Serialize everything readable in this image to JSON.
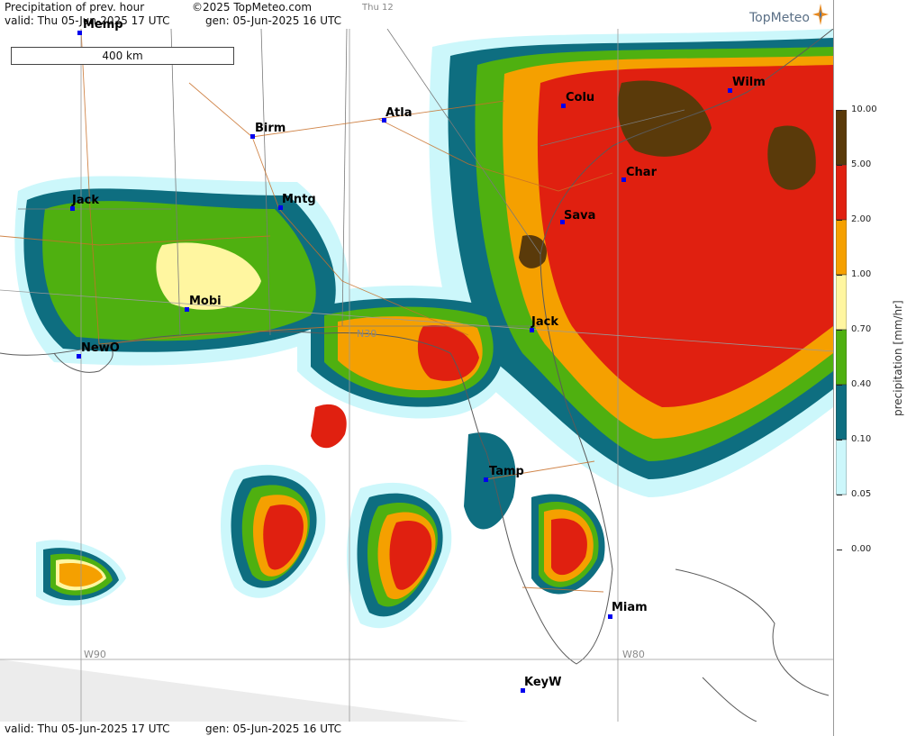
{
  "header": {
    "title": "Precipitation of prev. hour",
    "copyright": "©2025 TopMeteo.com",
    "valid": "valid:  Thu  05-Jun-2025  17 UTC",
    "gen": "gen:  05-Jun-2025 16 UTC",
    "day": "Thu 12"
  },
  "footer": {
    "valid": "valid:  Thu  05-Jun-2025  17 UTC",
    "gen": "gen:  05-Jun-2025 16 UTC"
  },
  "logo": {
    "text": "TopMeteo"
  },
  "scale_bar": {
    "label": "400 km"
  },
  "grid_labels": {
    "w90": "W90",
    "w80": "W80",
    "n30": "N30"
  },
  "cities": [
    {
      "name": "Memp"
    },
    {
      "name": "Atla"
    },
    {
      "name": "Birm"
    },
    {
      "name": "Colu"
    },
    {
      "name": "Wilm"
    },
    {
      "name": "Char"
    },
    {
      "name": "Sava"
    },
    {
      "name": "Jack"
    },
    {
      "name": "Mntg"
    },
    {
      "name": "Mobi"
    },
    {
      "name": "NewO"
    },
    {
      "name": "Jack"
    },
    {
      "name": "Tamp"
    },
    {
      "name": "Miam"
    },
    {
      "name": "KeyW"
    }
  ],
  "legend": {
    "title": "precipitation  [mm/hr]",
    "ticks": [
      "10.00",
      "5.00",
      "2.00",
      "1.00",
      "0.70",
      "0.40",
      "0.10",
      "0.05",
      "0.00"
    ],
    "colors": [
      "#5a3a0a",
      "#e02010",
      "#f5a000",
      "#fff6a0",
      "#4fb010",
      "#0e6e80",
      "#ccf7fb",
      "#ffffff"
    ]
  }
}
